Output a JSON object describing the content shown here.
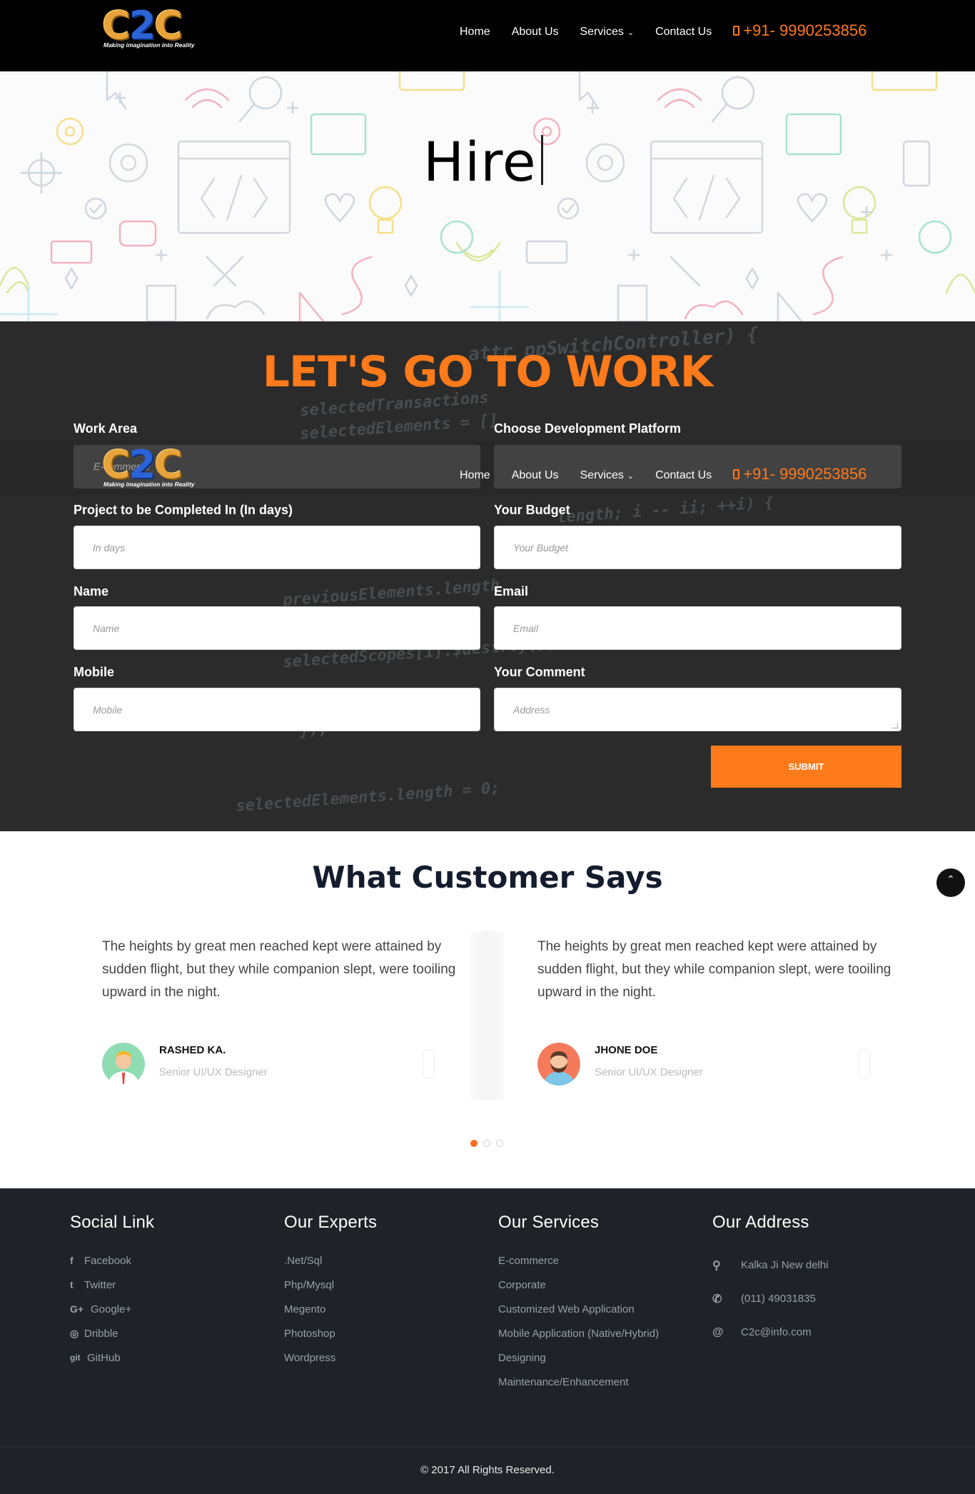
{
  "header": {
    "logo_text": "C2C",
    "logo_tagline": "Making imagination into Reality",
    "nav": [
      {
        "label": "Home"
      },
      {
        "label": "About Us"
      },
      {
        "label": "Services",
        "has_dropdown": true
      },
      {
        "label": "Contact Us"
      }
    ],
    "phone": "+91- 9990253856"
  },
  "hero": {
    "title": "Hire"
  },
  "work_form": {
    "heading": "LET'S GO TO WORK",
    "fields": {
      "work_area": {
        "label": "Work Area",
        "value": "E-commerce"
      },
      "platform": {
        "label": "Choose Development Platform",
        "value": ""
      },
      "days": {
        "label": "Project to be Completed In (In days)",
        "placeholder": "In days"
      },
      "budget": {
        "label": "Your Budget",
        "placeholder": "Your Budget"
      },
      "name": {
        "label": "Name",
        "placeholder": "Name"
      },
      "email": {
        "label": "Email",
        "placeholder": "Email"
      },
      "mobile": {
        "label": "Mobile",
        "placeholder": "Mobile"
      },
      "comment": {
        "label": "Your Comment",
        "placeholder": "Address"
      }
    },
    "submit_label": "SUBMIT"
  },
  "testimonials": {
    "heading": "What Customer Says",
    "items": [
      {
        "quote": "The heights by great men reached kept were attained by sudden flight, but they while companion slept, were tooiling upward in the night.",
        "name": "RASHED KA.",
        "role": "Senior UI/UX Designer"
      },
      {
        "quote": "The heights by great men reached kept were attained by sudden flight, but they while companion slept, were tooiling upward in the night.",
        "name": "JHONE DOE",
        "role": "Senior UI/UX Designer"
      }
    ],
    "pagination": {
      "pages": 3,
      "active": 1
    }
  },
  "footer": {
    "social": {
      "heading": "Social Link",
      "links": [
        {
          "icon": "facebook-icon",
          "glyph": "f",
          "label": "Facebook"
        },
        {
          "icon": "twitter-icon",
          "glyph": "t",
          "label": "Twitter"
        },
        {
          "icon": "google-plus-icon",
          "glyph": "G+",
          "label": "Google+"
        },
        {
          "icon": "dribbble-icon",
          "glyph": "◎",
          "label": "Dribble"
        },
        {
          "icon": "github-icon",
          "glyph": "git",
          "label": "GitHub"
        }
      ]
    },
    "experts": {
      "heading": "Our Experts",
      "items": [
        ".Net/Sql",
        "Php/Mysql",
        "Megento",
        "Photoshop",
        "Wordpress"
      ]
    },
    "services": {
      "heading": "Our Services",
      "items": [
        "E-commerce",
        "Corporate",
        "Customized Web Application",
        "Mobile Application (Native/Hybrid)",
        "Designing",
        "Maintenance/Enhancement"
      ]
    },
    "address": {
      "heading": "Our Address",
      "items": [
        {
          "icon": "map-pin-icon",
          "glyph": "⚲",
          "label": "Kalka Ji New delhi"
        },
        {
          "icon": "phone-icon",
          "glyph": "✆",
          "label": "(011) 49031835"
        },
        {
          "icon": "at-icon",
          "glyph": "@",
          "label": "C2c@info.com"
        }
      ]
    },
    "copyright": "© 2017 All Rights Reserved."
  },
  "colors": {
    "accent": "#ff7a1a",
    "header_bg": "#000000",
    "footer_bg": "#1f2226",
    "heading_dark": "#141c2e"
  }
}
